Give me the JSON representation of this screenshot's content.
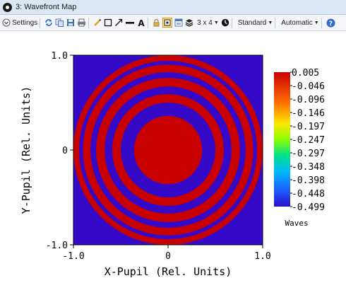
{
  "window": {
    "title": "3: Wavefront Map"
  },
  "toolbar": {
    "settings_label": "Settings",
    "layout_label": "3 x 4",
    "standard_label": "Standard",
    "automatic_label": "Automatic",
    "icons": [
      "settings-chevron-icon",
      "refresh-icon",
      "copy-icon",
      "save-icon",
      "print-icon",
      "pencil-icon",
      "rectangle-icon",
      "arrow-icon",
      "line-icon",
      "text-icon",
      "lock-icon",
      "fit-icon",
      "window-icon",
      "layers-icon",
      "clock-icon",
      "help-icon"
    ]
  },
  "colors": {
    "background_blue": "#3409c8",
    "ring_red": "#c80000",
    "frame": "#000000"
  },
  "chart_data": {
    "type": "heatmap",
    "title": "",
    "xlabel": "X-Pupil (Rel. Units)",
    "ylabel": "Y-Pupil (Rel. Units)",
    "xlim": [
      -1.0,
      1.0
    ],
    "ylim": [
      -1.0,
      1.0
    ],
    "x_ticks": [
      "-1.0",
      "0",
      "1.0"
    ],
    "y_ticks": [
      "1.0",
      "0",
      "-1.0"
    ],
    "colorbar": {
      "unit": "Waves",
      "max": 0.005,
      "min": -0.499,
      "tick_labels": [
        "0.005",
        "-0.046",
        "-0.096",
        "-0.146",
        "-0.197",
        "-0.247",
        "-0.297",
        "-0.348",
        "-0.398",
        "-0.448",
        "-0.499"
      ],
      "placement": "right"
    },
    "rings": [
      {
        "r_outer": 0.36,
        "r_inner": 0.0,
        "value": 0.005
      },
      {
        "r_outer": 0.59,
        "r_inner": 0.5,
        "value": 0.005
      },
      {
        "r_outer": 0.76,
        "r_inner": 0.67,
        "value": 0.005
      },
      {
        "r_outer": 0.9,
        "r_inner": 0.82,
        "value": 0.005
      },
      {
        "r_outer": 1.0,
        "r_inner": 0.94,
        "value": 0.005
      }
    ],
    "background_value": -0.499
  }
}
